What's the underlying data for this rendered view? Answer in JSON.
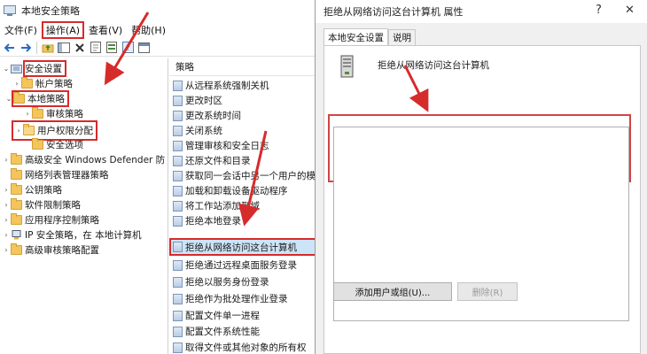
{
  "main_window": {
    "title": "本地安全策略",
    "menu": [
      {
        "label": "文件(F)",
        "highlighted": false
      },
      {
        "label": "操作(A)",
        "highlighted": true
      },
      {
        "label": "查看(V)",
        "highlighted": false
      },
      {
        "label": "帮助(H)",
        "highlighted": false
      }
    ],
    "toolbar_icons": [
      "back-arrow-icon",
      "forward-arrow-icon",
      "up-folder-icon",
      "show-hide-tree-icon",
      "delete-icon",
      "properties-icon",
      "export-list-icon",
      "help-icon",
      "console-icon"
    ]
  },
  "tree": {
    "items": [
      {
        "label": "安全设置",
        "level": 0,
        "expander": "⌄",
        "icon": "security-settings-icon",
        "highlighted": true
      },
      {
        "label": "帐户策略",
        "level": 1,
        "expander": "›",
        "icon": "folder-icon",
        "highlighted": false
      },
      {
        "label": "本地策略",
        "level": 1,
        "expander": "⌄",
        "icon": "folder-icon",
        "highlighted": true
      },
      {
        "label": "审核策略",
        "level": 2,
        "expander": "›",
        "icon": "folder-icon",
        "highlighted": false
      },
      {
        "label": "用户权限分配",
        "level": 2,
        "expander": "›",
        "icon": "folder-open-icon",
        "highlighted": true
      },
      {
        "label": "安全选项",
        "level": 2,
        "expander": "",
        "icon": "folder-icon",
        "highlighted": false
      },
      {
        "label": "高级安全 Windows Defender 防",
        "level": 0,
        "expander": "›",
        "icon": "folder-icon",
        "highlighted": false
      },
      {
        "label": "网络列表管理器策略",
        "level": 0,
        "expander": "",
        "icon": "folder-icon",
        "highlighted": false
      },
      {
        "label": "公钥策略",
        "level": 0,
        "expander": "›",
        "icon": "folder-icon",
        "highlighted": false
      },
      {
        "label": "软件限制策略",
        "level": 0,
        "expander": "›",
        "icon": "folder-icon",
        "highlighted": false
      },
      {
        "label": "应用程序控制策略",
        "level": 0,
        "expander": "›",
        "icon": "folder-icon",
        "highlighted": false
      },
      {
        "label": "IP 安全策略，在 本地计算机",
        "level": 0,
        "expander": "›",
        "icon": "ip-security-icon",
        "highlighted": false
      },
      {
        "label": "高级审核策略配置",
        "level": 0,
        "expander": "›",
        "icon": "folder-icon",
        "highlighted": false
      }
    ]
  },
  "list": {
    "header": "策略",
    "rows": [
      {
        "label": "从远程系统强制关机",
        "selected": false
      },
      {
        "label": "更改时区",
        "selected": false
      },
      {
        "label": "更改系统时间",
        "selected": false
      },
      {
        "label": "关闭系统",
        "selected": false
      },
      {
        "label": "管理审核和安全日志",
        "selected": false
      },
      {
        "label": "还原文件和目录",
        "selected": false
      },
      {
        "label": "获取同一会话中另一个用户的模",
        "selected": false
      },
      {
        "label": "加载和卸载设备驱动程序",
        "selected": false
      },
      {
        "label": "将工作站添加到域",
        "selected": false
      },
      {
        "label": "拒绝本地登录",
        "selected": false
      },
      {
        "label": "拒绝从网络访问这台计算机",
        "selected": true
      },
      {
        "label": "拒绝通过远程桌面服务登录",
        "selected": false
      },
      {
        "label": "拒绝以服务身份登录",
        "selected": false
      },
      {
        "label": "拒绝作为批处理作业登录",
        "selected": false
      },
      {
        "label": "配置文件单一进程",
        "selected": false
      },
      {
        "label": "配置文件系统性能",
        "selected": false
      },
      {
        "label": "取得文件或其他对象的所有权",
        "selected": false
      }
    ]
  },
  "dialog": {
    "title": "拒绝从网络访问这台计算机 属性",
    "help_button": "?",
    "close_button": "✕",
    "tabs": [
      {
        "label": "本地安全设置",
        "active": true
      },
      {
        "label": "说明",
        "active": false
      }
    ],
    "policy_name": "拒绝从网络访问这台计算机",
    "add_button": "添加用户或组(U)...",
    "remove_button": "删除(R)"
  },
  "colors": {
    "annotation_red": "#d62b2b",
    "selection_blue": "#cce4f7",
    "folder_yellow": "#f3c55a"
  }
}
